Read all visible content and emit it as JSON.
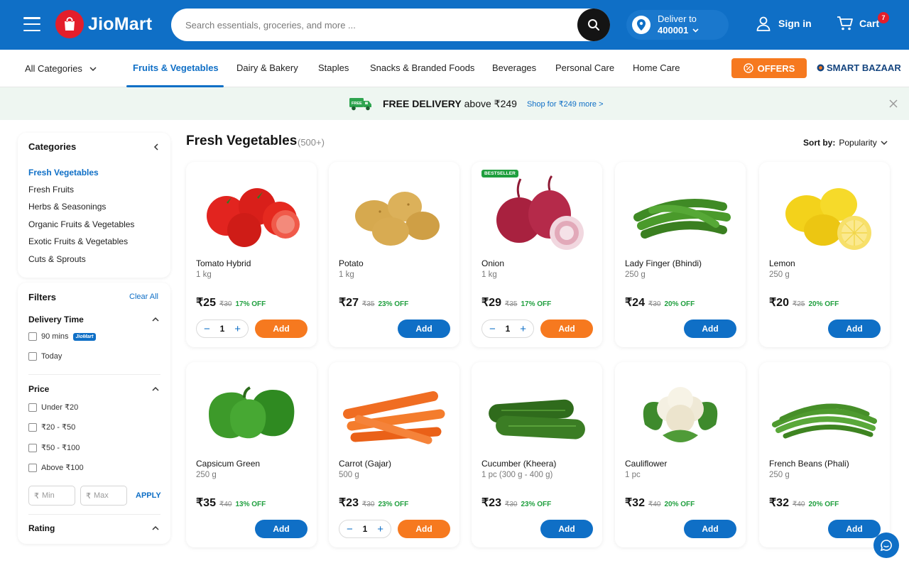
{
  "header": {
    "logo_text": "JioMart",
    "search_placeholder": "Search essentials, groceries, and more ...",
    "deliver_label": "Deliver to",
    "deliver_pincode": "400001",
    "signin_label": "Sign in",
    "cart_label": "Cart",
    "cart_count": "7"
  },
  "nav": {
    "all_categories": "All Categories",
    "items": [
      "Fruits & Vegetables",
      "Dairy & Bakery",
      "Staples",
      "Snacks & Branded Foods",
      "Beverages",
      "Personal Care",
      "Home Care"
    ],
    "offers_label": "OFFERS",
    "smart_bazaar": "SMART BAZAAR"
  },
  "banner": {
    "truck_text": "FREE",
    "title_bold": "FREE DELIVERY",
    "title_rest": " above ₹249",
    "link": "Shop for ₹249 more >"
  },
  "sidebar": {
    "categories_title": "Categories",
    "categories": [
      "Fresh Vegetables",
      "Fresh Fruits",
      "Herbs & Seasonings",
      "Organic Fruits & Vegetables",
      "Exotic Fruits & Vegetables",
      "Cuts & Sprouts"
    ],
    "filters_title": "Filters",
    "clear_all": "Clear All",
    "delivery_title": "Delivery Time",
    "delivery_options": [
      "90 mins",
      "Today"
    ],
    "delivery_badge": "JioMart",
    "price_title": "Price",
    "price_options": [
      "Under ₹20",
      "₹20 - ₹50",
      "₹50 - ₹100",
      "Above ₹100"
    ],
    "rupee": "₹",
    "min_placeholder": "Min",
    "max_placeholder": "Max",
    "apply": "APPLY",
    "rating_title": "Rating"
  },
  "main": {
    "title": "Fresh Vegetables",
    "count": "(500+)",
    "sort_label": "Sort by:",
    "sort_value": "Popularity"
  },
  "products": [
    {
      "name": "Tomato Hybrid",
      "qty": "1 kg",
      "price": "₹25",
      "mrp": "₹30",
      "off": "17% OFF",
      "add": "Add",
      "in_cart": true,
      "count": "1",
      "img": "tomato-image"
    },
    {
      "name": "Potato",
      "qty": "1 kg",
      "price": "₹27",
      "mrp": "₹35",
      "off": "23% OFF",
      "add": "Add",
      "in_cart": false,
      "img": "potato-image"
    },
    {
      "name": "Onion",
      "qty": "1 kg",
      "price": "₹29",
      "mrp": "₹35",
      "off": "17% OFF",
      "add": "Add",
      "in_cart": true,
      "count": "1",
      "badge": "BESTSELLER",
      "img": "onion-image"
    },
    {
      "name": "Lady Finger (Bhindi)",
      "qty": "250 g",
      "price": "₹24",
      "mrp": "₹30",
      "off": "20% OFF",
      "add": "Add",
      "in_cart": false,
      "img": "lady-finger-image"
    },
    {
      "name": "Lemon",
      "qty": "250 g",
      "price": "₹20",
      "mrp": "₹25",
      "off": "20% OFF",
      "add": "Add",
      "in_cart": false,
      "img": "lemon-image"
    },
    {
      "name": "Capsicum Green",
      "qty": "250 g",
      "price": "₹35",
      "mrp": "₹40",
      "off": "13% OFF",
      "add": "Add",
      "in_cart": false,
      "img": "capsicum-image"
    },
    {
      "name": "Carrot (Gajar)",
      "qty": "500 g",
      "price": "₹23",
      "mrp": "₹30",
      "off": "23% OFF",
      "add": "Add",
      "in_cart": true,
      "count": "1",
      "img": "carrot-image"
    },
    {
      "name": "Cucumber (Kheera)",
      "qty": "1 pc (300 g - 400 g)",
      "price": "₹23",
      "mrp": "₹30",
      "off": "23% OFF",
      "add": "Add",
      "in_cart": false,
      "img": "cucumber-image"
    },
    {
      "name": "Cauliflower",
      "qty": "1 pc",
      "price": "₹32",
      "mrp": "₹40",
      "off": "20% OFF",
      "add": "Add",
      "in_cart": false,
      "img": "cauliflower-image"
    },
    {
      "name": "French Beans (Phali)",
      "qty": "250 g",
      "price": "₹32",
      "mrp": "₹40",
      "off": "20% OFF",
      "add": "Add",
      "in_cart": false,
      "img": "french-beans-image"
    }
  ],
  "colors": {
    "brand_blue": "#0f6fc6",
    "accent_orange": "#f6791f",
    "discount_green": "#1f9f3e",
    "logo_red": "#e41e2b"
  }
}
